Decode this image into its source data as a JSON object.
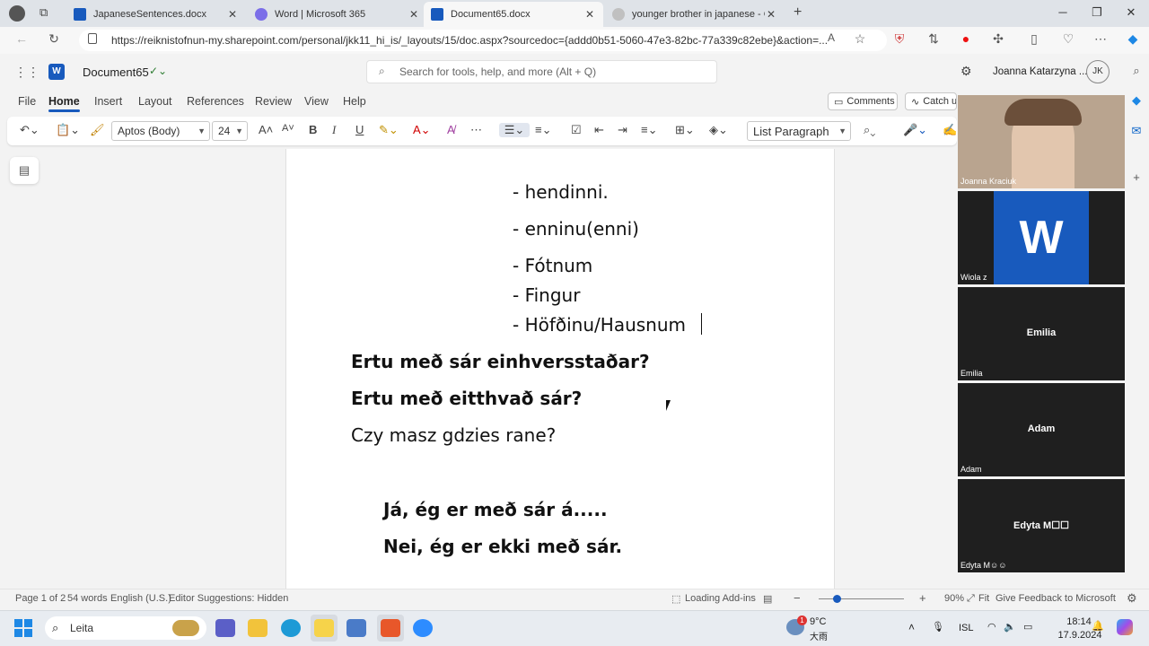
{
  "browser": {
    "tabs": [
      {
        "title": "JapaneseSentences.docx",
        "color": "#185abd"
      },
      {
        "title": "Word | Microsoft 365",
        "color": "#7b6ee8"
      },
      {
        "title": "Document65.docx",
        "color": "#185abd"
      },
      {
        "title": "younger brother in japanese - Go",
        "color": "#c0c0c0"
      }
    ],
    "url": "https://reiknistofnun-my.sharepoint.com/personal/jkk11_hi_is/_layouts/15/doc.aspx?sourcedoc={addd0b51-5060-47e3-82bc-77a339c82ebe}&action=..."
  },
  "office": {
    "doc_title": "Document65",
    "search_placeholder": "Search for tools, help, and more (Alt + Q)",
    "user_name": "Joanna Katarzyna ...",
    "user_initials": "JK"
  },
  "ribbon": {
    "tabs": [
      "File",
      "Home",
      "Insert",
      "Layout",
      "References",
      "Review",
      "View",
      "Help"
    ],
    "comments": "Comments",
    "catchup": "Catch up",
    "font": "Aptos (Body)",
    "size": "24",
    "style": "List Paragraph"
  },
  "document": {
    "lines": [
      {
        "text": "- hendinni.",
        "bold": false
      },
      {
        "text": "- enninu(enni)",
        "bold": false
      },
      {
        "text": "-  Fótnum",
        "bold": false
      },
      {
        "text": "-  Fingur",
        "bold": false
      },
      {
        "text": "-  Höfðinu/Hausnum",
        "bold": false
      },
      {
        "text": "Ertu með sár einhversstaðar?",
        "bold": true
      },
      {
        "text": "Ertu með eitthvað sár?",
        "bold": true
      },
      {
        "text": "Czy masz gdzies rane?",
        "bold": false
      },
      {
        "text": "Já, ég er með sár á.....",
        "bold": true
      },
      {
        "text": "Nei, ég er ekki með sár.",
        "bold": true
      }
    ]
  },
  "status": {
    "page": "Page 1 of 2",
    "words": "54 words",
    "language": "English (U.S.)",
    "editor": "Editor Suggestions: Hidden",
    "addins": "Loading Add-ins",
    "zoom": "90%",
    "fit": "Fit",
    "feedback": "Give Feedback to Microsoft"
  },
  "participants": [
    {
      "name": "Joanna Kraciuk",
      "center": ""
    },
    {
      "name": "Wiola z",
      "center": "W"
    },
    {
      "name": "Emilia",
      "center": "Emilia"
    },
    {
      "name": "Adam",
      "center": "Adam"
    },
    {
      "name": "Edyta M☺☺",
      "center": "Edyta M☐☐"
    }
  ],
  "taskbar": {
    "search": "Leita",
    "temperature": "9°C",
    "weather": "大雨",
    "lang": "ISL",
    "time": "18:14",
    "date": "17.9.2024",
    "badge": "1"
  }
}
